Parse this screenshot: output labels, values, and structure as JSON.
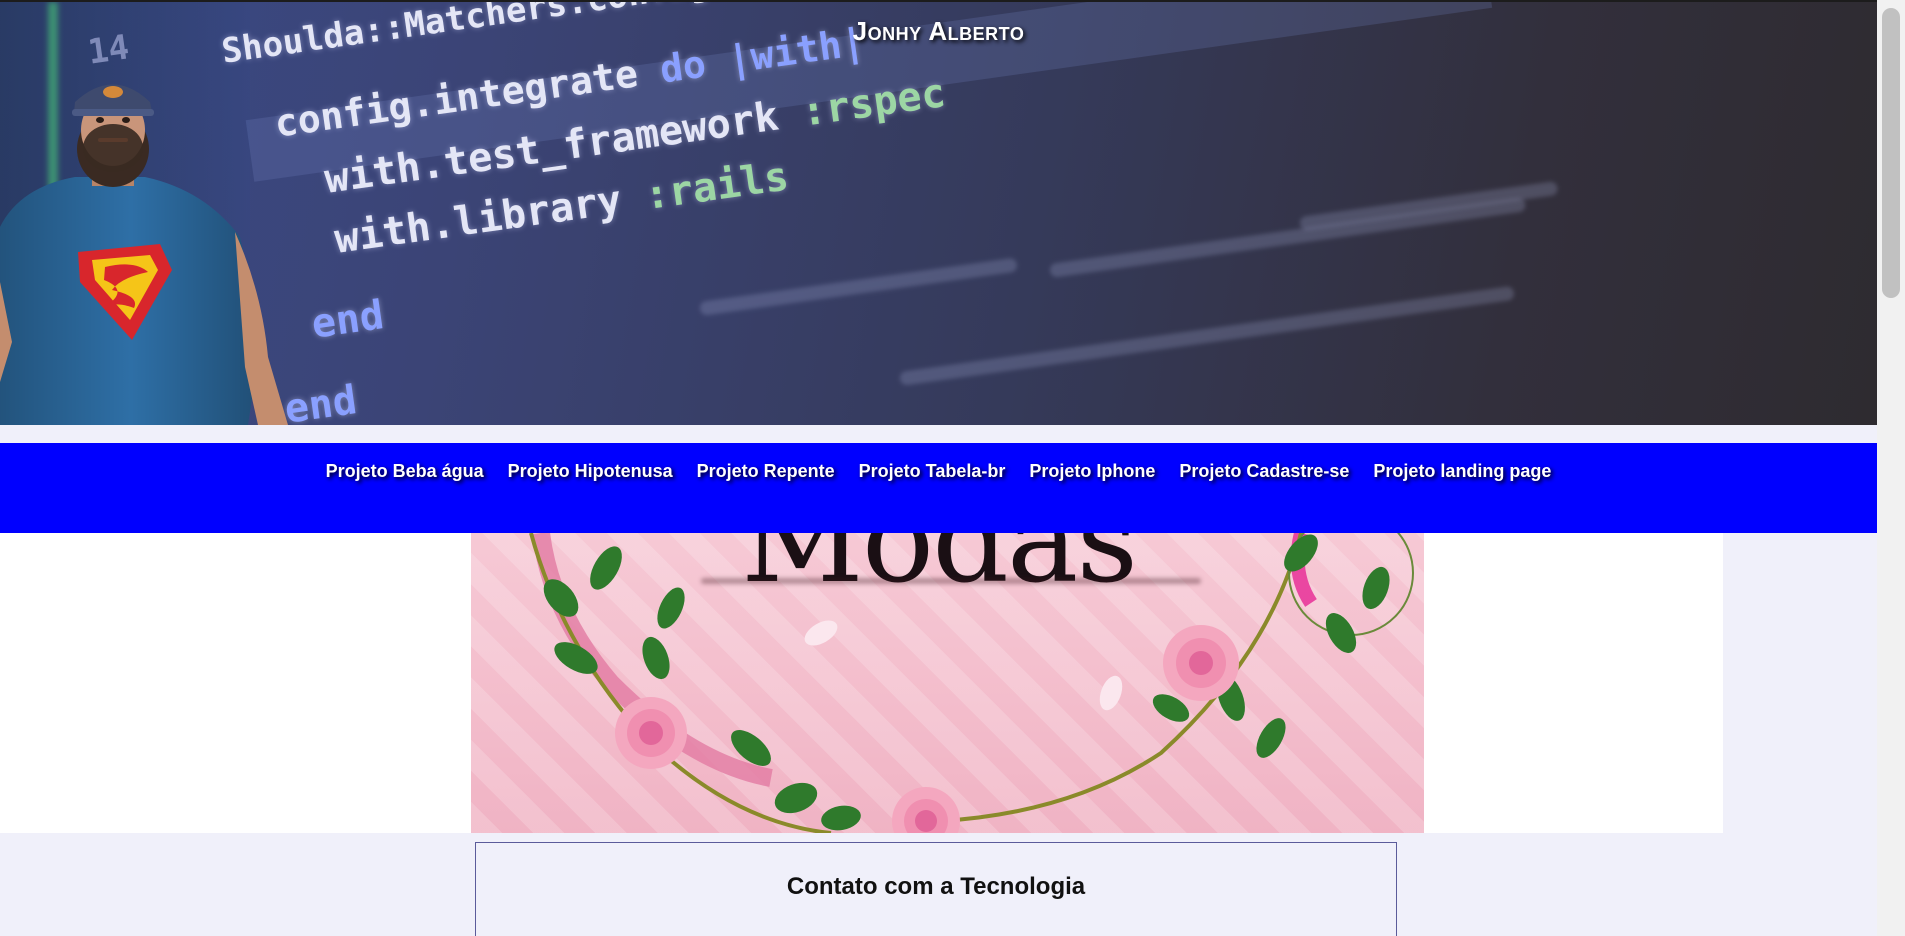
{
  "header": {
    "title": "Jonhy Alberto",
    "code_lines": [
      {
        "parts": [
          {
            "t": "Shoulda::Matchers.config",
            "c": ""
          }
        ]
      },
      {
        "parts": [
          {
            "t": "config.integrate ",
            "c": ""
          },
          {
            "t": "do ",
            "c": "kw"
          },
          {
            "t": "|with|",
            "c": "kw"
          }
        ]
      },
      {
        "parts": [
          {
            "t": "with.test_framework ",
            "c": ""
          },
          {
            "t": ":rspec",
            "c": "sym"
          }
        ]
      },
      {
        "parts": [
          {
            "t": "with.library ",
            "c": ""
          },
          {
            "t": ":rails",
            "c": "sym"
          }
        ]
      },
      {
        "parts": [
          {
            "t": "end",
            "c": "kw"
          }
        ]
      },
      {
        "parts": [
          {
            "t": "end",
            "c": "kw"
          }
        ]
      }
    ],
    "line_number": "14"
  },
  "nav": {
    "items": [
      {
        "label": "Projeto Beba água"
      },
      {
        "label": "Projeto Hipotenusa"
      },
      {
        "label": "Projeto Repente"
      },
      {
        "label": "Projeto Tabela-br"
      },
      {
        "label": "Projeto Iphone"
      },
      {
        "label": "Projeto Cadastre-se"
      },
      {
        "label": "Projeto landing page"
      }
    ]
  },
  "banner_image": {
    "word": "Modas"
  },
  "contact": {
    "title": "Contato com a Tecnologia"
  },
  "colors": {
    "nav_bg": "#0000ff",
    "page_bg": "#f0f0fa",
    "rose": "#f4a7bf",
    "leaf": "#2f7a2c"
  }
}
